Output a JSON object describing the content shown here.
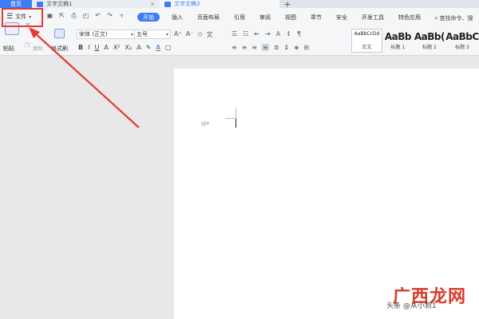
{
  "tabs": {
    "home": "首页",
    "doc1": "文字文稿1",
    "doc3": "文字文稿3",
    "close": "×",
    "add": "+"
  },
  "menu": {
    "file": "文件",
    "ribbon_tabs": [
      "开始",
      "插入",
      "页面布局",
      "引用",
      "审阅",
      "视图",
      "章节",
      "安全",
      "开发工具",
      "特色应用"
    ],
    "search": "查找命令、搜"
  },
  "clipboard": {
    "paste": "粘贴",
    "copy": "复制",
    "format_painter": "格式刷"
  },
  "font": {
    "family": "宋体 (正文)",
    "size": "五号"
  },
  "styles": [
    {
      "preview": "AaBbCcDd",
      "name": "正文"
    },
    {
      "preview": "AaBb",
      "name": "标题 1"
    },
    {
      "preview": "AaBb(",
      "name": "标题 2"
    },
    {
      "preview": "AaBbC",
      "name": "标题 3"
    }
  ],
  "watermark": {
    "brand": "广西龙网",
    "sub": "头条 @从小到1"
  },
  "colors": {
    "accent": "#3c7df5",
    "highlight": "#e53935"
  }
}
